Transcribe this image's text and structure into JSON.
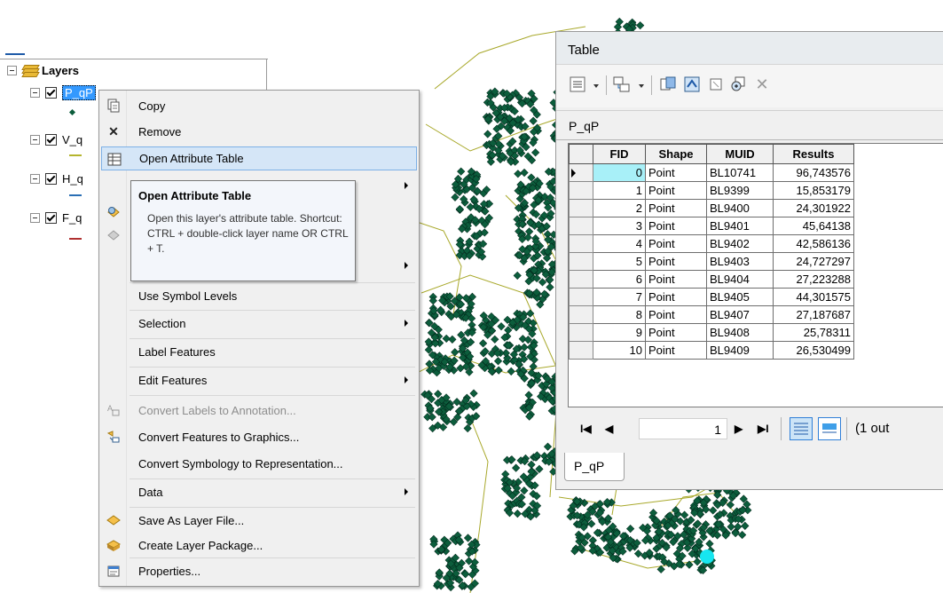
{
  "toc": {
    "root_label": "Layers",
    "layers": [
      {
        "name": "P_qP",
        "selected": true,
        "legend": "dot",
        "color": "#0c5d3c"
      },
      {
        "name": "V_q",
        "selected": false,
        "legend": "line",
        "color": "#b5b52e"
      },
      {
        "name": "H_q",
        "selected": false,
        "legend": "line",
        "color": "#2a6fb5"
      },
      {
        "name": "F_q",
        "selected": false,
        "legend": "line",
        "color": "#b03030"
      }
    ]
  },
  "context_menu": {
    "items": [
      {
        "label": "Copy",
        "icon": "copy-icon",
        "submenu": false,
        "disabled": false,
        "highlighted": false
      },
      {
        "label": "Remove",
        "icon": "remove-icon",
        "submenu": false,
        "disabled": false,
        "highlighted": false
      },
      {
        "label": "Open Attribute Table",
        "icon": "table-icon",
        "submenu": false,
        "disabled": false,
        "highlighted": true
      },
      {
        "label": "",
        "icon": "",
        "submenu": true,
        "disabled": false,
        "highlighted": false
      },
      {
        "label": "",
        "icon": "zoom-layer-icon",
        "submenu": false,
        "disabled": false,
        "highlighted": false
      },
      {
        "label": "",
        "icon": "scale-range-icon",
        "submenu": false,
        "disabled": true,
        "highlighted": false
      },
      {
        "label": "",
        "icon": "",
        "submenu": true,
        "disabled": false,
        "highlighted": false
      },
      {
        "label": "Use Symbol Levels",
        "icon": "",
        "submenu": false,
        "disabled": false,
        "highlighted": false
      },
      {
        "label": "Selection",
        "icon": "",
        "submenu": true,
        "disabled": false,
        "highlighted": false
      },
      {
        "label": "Label Features",
        "icon": "",
        "submenu": false,
        "disabled": false,
        "highlighted": false
      },
      {
        "label": "Edit Features",
        "icon": "",
        "submenu": true,
        "disabled": false,
        "highlighted": false
      },
      {
        "label": "Convert Labels to Annotation...",
        "icon": "convert-labels-icon",
        "submenu": false,
        "disabled": true,
        "highlighted": false
      },
      {
        "label": "Convert Features to Graphics...",
        "icon": "convert-graphics-icon",
        "submenu": false,
        "disabled": false,
        "highlighted": false
      },
      {
        "label": "Convert Symbology to Representation...",
        "icon": "",
        "submenu": false,
        "disabled": false,
        "highlighted": false
      },
      {
        "label": "Data",
        "icon": "",
        "submenu": true,
        "disabled": false,
        "highlighted": false
      },
      {
        "label": "Save As Layer File...",
        "icon": "layer-file-icon",
        "submenu": false,
        "disabled": false,
        "highlighted": false
      },
      {
        "label": "Create Layer Package...",
        "icon": "layer-package-icon",
        "submenu": false,
        "disabled": false,
        "highlighted": false
      },
      {
        "label": "Properties...",
        "icon": "properties-icon",
        "submenu": false,
        "disabled": false,
        "highlighted": false
      }
    ]
  },
  "tooltip": {
    "title": "Open Attribute Table",
    "body": "Open this layer's attribute table. Shortcut: CTRL + double-click layer name OR CTRL + T."
  },
  "table_window": {
    "title": "Table",
    "table_name": "P_qP",
    "columns": [
      "FID",
      "Shape",
      "MUID",
      "Results"
    ],
    "rows": [
      [
        "0",
        "Point",
        "BL10741",
        "96,743576"
      ],
      [
        "1",
        "Point",
        "BL9399",
        "15,853179"
      ],
      [
        "2",
        "Point",
        "BL9400",
        "24,301922"
      ],
      [
        "3",
        "Point",
        "BL9401",
        "45,64138"
      ],
      [
        "4",
        "Point",
        "BL9402",
        "42,586136"
      ],
      [
        "5",
        "Point",
        "BL9403",
        "24,727297"
      ],
      [
        "6",
        "Point",
        "BL9404",
        "27,223288"
      ],
      [
        "7",
        "Point",
        "BL9405",
        "44,301575"
      ],
      [
        "8",
        "Point",
        "BL9407",
        "27,187687"
      ],
      [
        "9",
        "Point",
        "BL9408",
        "25,78311"
      ],
      [
        "10",
        "Point",
        "BL9409",
        "26,530499"
      ]
    ],
    "current_row": 0,
    "nav": {
      "current_record": "1",
      "status": "(1 out"
    },
    "tab_label": "P_qP"
  },
  "colors": {
    "feature_fill": "#0c5d3c",
    "line_color": "#a8a82a",
    "highlight_point": "#17e6f0",
    "menu_highlight": "#d5e6f7"
  }
}
